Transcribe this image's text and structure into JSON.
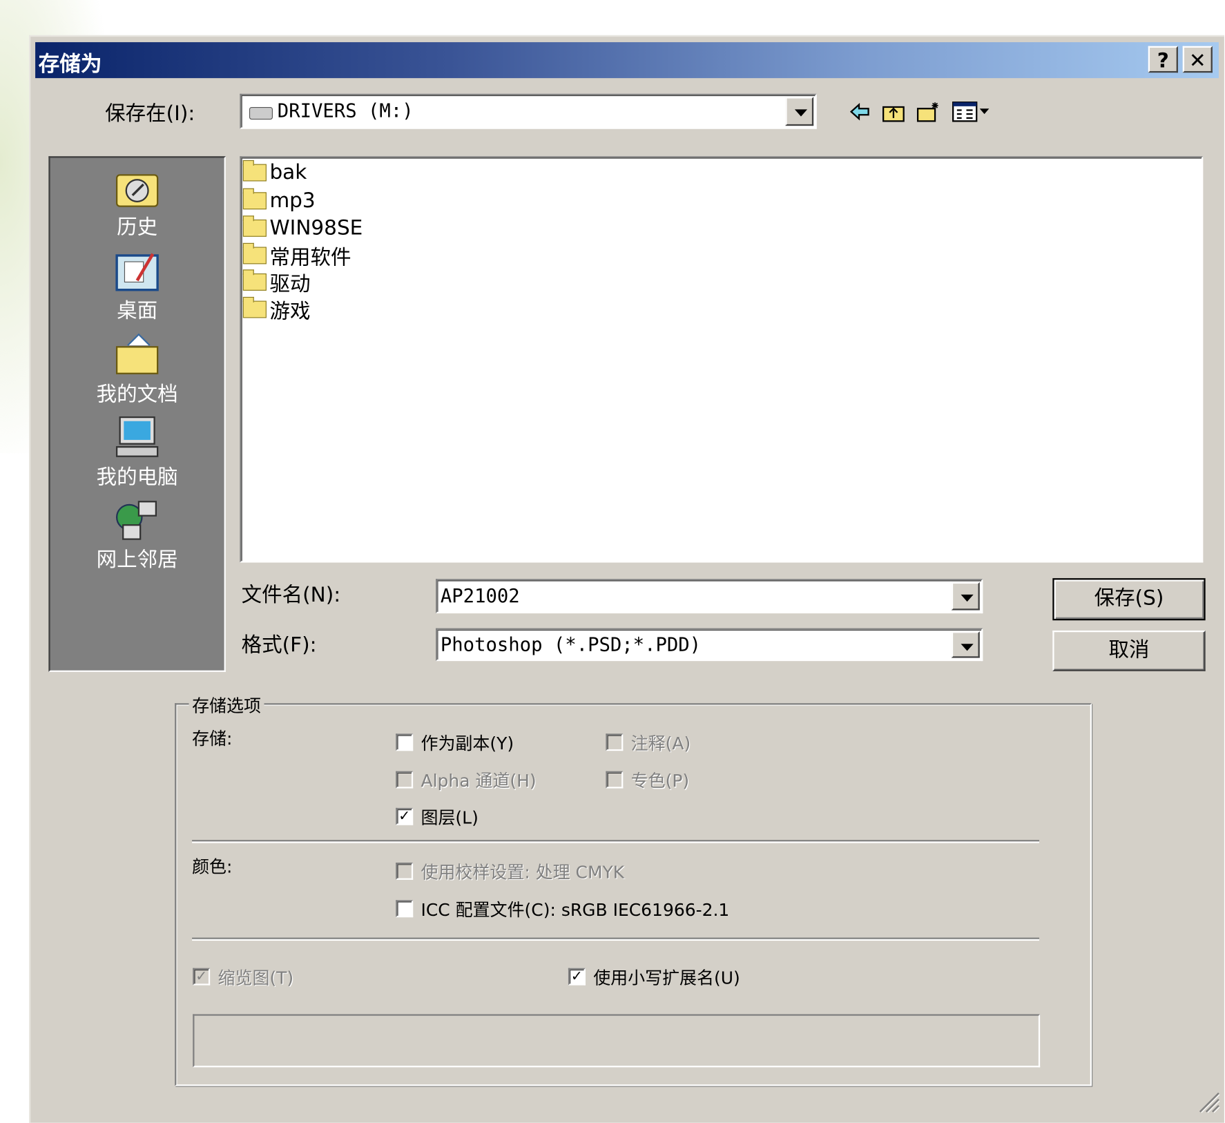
{
  "window": {
    "title": "存储为",
    "help": "?",
    "close": "✕"
  },
  "location": {
    "label": "保存在(I):",
    "value": "DRIVERS (M:)"
  },
  "toolbar": {
    "icons": [
      "back-icon",
      "up-folder-icon",
      "new-folder-icon",
      "view-menu-icon"
    ]
  },
  "places": [
    {
      "label": "历史",
      "icon": "history-icon"
    },
    {
      "label": "桌面",
      "icon": "desktop-icon"
    },
    {
      "label": "我的文档",
      "icon": "my-documents-icon"
    },
    {
      "label": "我的电脑",
      "icon": "my-computer-icon"
    },
    {
      "label": "网上邻居",
      "icon": "network-icon"
    }
  ],
  "files": [
    "bak",
    "mp3",
    "WIN98SE",
    "常用软件",
    "驱动",
    "游戏"
  ],
  "filename": {
    "label": "文件名(N):",
    "value": "AP21002"
  },
  "format": {
    "label": "格式(F):",
    "value": "Photoshop (*.PSD;*.PDD)"
  },
  "buttons": {
    "save": "保存(S)",
    "cancel": "取消"
  },
  "options": {
    "legend": "存储选项",
    "save_label": "存储:",
    "as_copy": {
      "label": "作为副本(Y)",
      "checked": false,
      "enabled": true
    },
    "annotations": {
      "label": "注释(A)",
      "checked": false,
      "enabled": false
    },
    "alpha": {
      "label": "Alpha 通道(H)",
      "checked": false,
      "enabled": false
    },
    "spot": {
      "label": "专色(P)",
      "checked": false,
      "enabled": false
    },
    "layers": {
      "label": "图层(L)",
      "checked": true,
      "enabled": true
    },
    "color_label": "颜色:",
    "proof": {
      "label": "使用校样设置: 处理 CMYK",
      "checked": false,
      "enabled": false
    },
    "icc": {
      "label": "ICC 配置文件(C): sRGB IEC61966-2.1",
      "checked": false,
      "enabled": true
    },
    "thumbnail": {
      "label": "缩览图(T)",
      "checked": true,
      "enabled": false
    },
    "lowercase": {
      "label": "使用小写扩展名(U)",
      "checked": true,
      "enabled": true
    }
  }
}
